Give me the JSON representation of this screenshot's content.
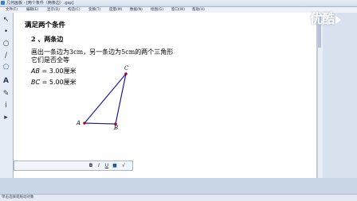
{
  "window": {
    "title": "几何画板 - [两个条件（两条边）.gsp]"
  },
  "menu": [
    "文件(F)",
    "编辑(E)",
    "显示(D)",
    "构造(C)",
    "变换(T)",
    "度量(M)",
    "数据(N)",
    "绘图(G)",
    "窗口(W)",
    "帮助(H)"
  ],
  "watermark": "优酷",
  "tools": [
    {
      "name": "arrow-tool",
      "glyph": "↖"
    },
    {
      "name": "point-tool",
      "glyph": "•"
    },
    {
      "name": "compass-tool",
      "glyph": "○"
    },
    {
      "name": "line-tool",
      "glyph": "/"
    },
    {
      "name": "polygon-tool",
      "glyph": "⬠"
    },
    {
      "name": "text-tool",
      "glyph": "A"
    },
    {
      "name": "marker-tool",
      "glyph": "✎"
    },
    {
      "name": "info-tool",
      "glyph": "i"
    },
    {
      "name": "custom-tool",
      "glyph": "▸"
    }
  ],
  "canvas": {
    "heading": "满足两个条件",
    "subheading": "2 、两条边",
    "task_line1": "画出一条边为3cm，另一条边为5cm的两个三角形",
    "task_line2": "它们是否全等",
    "measure1": {
      "var": "AB",
      "value": " = 3.00厘米"
    },
    "measure2": {
      "var": "BC",
      "value": " = 5.00厘米"
    },
    "points": {
      "A": "A",
      "B": "B",
      "C": "C"
    }
  },
  "format_bar": {
    "bold": "B",
    "italic": "I",
    "underline": "U",
    "color": "■",
    "symbol": "√"
  },
  "status": {
    "text": "单击选择或拖动对象"
  }
}
